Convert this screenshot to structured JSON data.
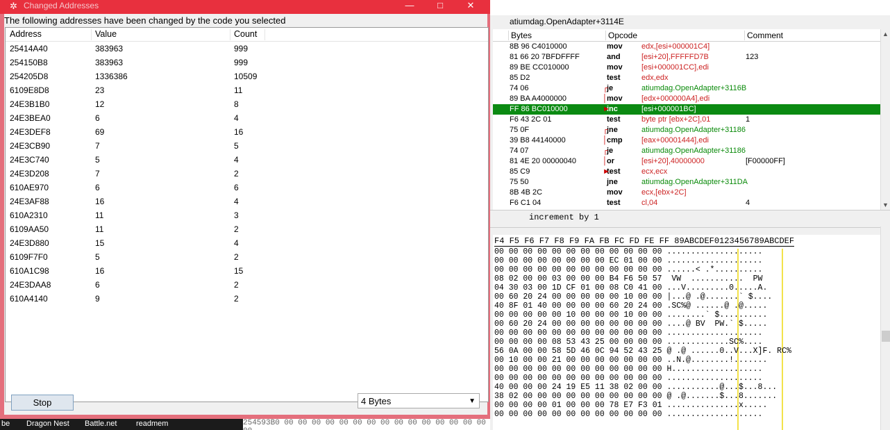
{
  "dialog": {
    "title": "Changed Addresses",
    "message": "The following addresses have been changed by the code you selected",
    "columns": [
      "Address",
      "Value",
      "Count"
    ],
    "rows": [
      [
        "25414A40",
        "383963",
        "999"
      ],
      [
        "254150B8",
        "383963",
        "999"
      ],
      [
        "254205D8",
        "1336386",
        "10509"
      ],
      [
        "6109E8D8",
        "23",
        "11"
      ],
      [
        "24E3B1B0",
        "12",
        "8"
      ],
      [
        "24E3BEA0",
        "6",
        "4"
      ],
      [
        "24E3DEF8",
        "69",
        "16"
      ],
      [
        "24E3CB90",
        "7",
        "5"
      ],
      [
        "24E3C740",
        "5",
        "4"
      ],
      [
        "24E3D208",
        "7",
        "2"
      ],
      [
        "610AE970",
        "6",
        "6"
      ],
      [
        "24E3AF88",
        "16",
        "4"
      ],
      [
        "610A2310",
        "11",
        "3"
      ],
      [
        "6109AA50",
        "11",
        "2"
      ],
      [
        "24E3D880",
        "15",
        "4"
      ],
      [
        "6109F7F0",
        "5",
        "2"
      ],
      [
        "610A1C98",
        "16",
        "15"
      ],
      [
        "24E3DAA8",
        "6",
        "2"
      ],
      [
        "610A4140",
        "9",
        "2"
      ]
    ],
    "stop_label": "Stop",
    "size_value": "4 Bytes",
    "minimize_glyph": "—",
    "maximize_glyph": "□",
    "close_glyph": "✕"
  },
  "disassembler": {
    "address_label": "atiumdag.OpenAdapter+3114E",
    "columns": [
      "Bytes",
      "Opcode",
      "Comment"
    ],
    "rows": [
      {
        "bytes": "8B 96 C4010000",
        "op": "mov",
        "arg": "edx,[esi+000001C4]",
        "comment": ""
      },
      {
        "bytes": "81 66 20 7BFDFFFF",
        "op": "and",
        "arg": "[esi+20],FFFFFD7B",
        "comment": "123"
      },
      {
        "bytes": "89 BE CC010000",
        "op": "mov",
        "arg": "[esi+000001CC],edi",
        "comment": ""
      },
      {
        "bytes": "85 D2",
        "op": "test",
        "arg": "edx,edx",
        "comment": ""
      },
      {
        "bytes": "74 06",
        "op": "je",
        "arg": "atiumdag.OpenAdapter+3116B",
        "comment": ""
      },
      {
        "bytes": "89 BA A4000000",
        "op": "mov",
        "arg": "[edx+000000A4],edi",
        "comment": ""
      },
      {
        "bytes": "FF 86 BC010000",
        "op": "inc",
        "arg": "[esi+000001BC]",
        "comment": ""
      },
      {
        "bytes": "F6 43 2C 01",
        "op": "test",
        "arg": "byte ptr [ebx+2C],01",
        "comment": "1"
      },
      {
        "bytes": "75 0F",
        "op": "jne",
        "arg": "atiumdag.OpenAdapter+31186",
        "comment": ""
      },
      {
        "bytes": "39 B8 44140000",
        "op": "cmp",
        "arg": "[eax+00001444],edi",
        "comment": ""
      },
      {
        "bytes": "74 07",
        "op": "je",
        "arg": "atiumdag.OpenAdapter+31186",
        "comment": ""
      },
      {
        "bytes": "81 4E 20 00000040",
        "op": "or",
        "arg": "[esi+20],40000000",
        "comment": "[F00000FF]"
      },
      {
        "bytes": "85 C9",
        "op": "test",
        "arg": "ecx,ecx",
        "comment": ""
      },
      {
        "bytes": "75 50",
        "op": "jne",
        "arg": "atiumdag.OpenAdapter+311DA",
        "comment": ""
      },
      {
        "bytes": "8B 4B 2C",
        "op": "mov",
        "arg": "ecx,[ebx+2C]",
        "comment": ""
      },
      {
        "bytes": "F6 C1 04",
        "op": "test",
        "arg": "cl,04",
        "comment": "4"
      }
    ],
    "selected_row": 6,
    "status_text": "increment by 1"
  },
  "hexview": {
    "header": "F4 F5 F6 F7 F8 F9 FA FB FC FD FE FF 89ABCDEF0123456789ABCDEF",
    "rows": [
      "00 00 00 00 00 00 00 00 00 00 00 00 ....................",
      "00 00 00 00 00 00 00 00 EC 01 00 00 ....................",
      "00 00 00 00 00 00 00 00 00 00 00 00 ......< .*..........",
      "08 02 00 00 03 00 00 00 B4 F6 50 57  VW  ...........  PW",
      "04 30 03 00 1D CF 01 00 08 C0 41 00 ...V.........0.....A.",
      "00 60 20 24 00 00 00 00 00 10 00 00 |...@ .@.......` $....",
      "40 8F 01 40 00 00 00 00 60 20 24 00 .SC%@ ......@ .@.....",
      "00 00 00 00 00 10 00 00 00 10 00 00 ........` $..........",
      "00 60 20 24 00 00 00 00 00 00 00 00 ....@ BV  PW.` $.....",
      "00 00 00 00 00 00 00 00 00 00 00 00 ....................",
      "00 00 00 00 08 53 43 25 00 00 00 00 .............SC%....",
      "56 0A 00 00 58 5D 46 0C 94 52 43 25 @ .@ ......0..V...X]F. RC%",
      "00 10 00 00 21 00 00 00 00 00 00 00 ..N.@........!.......",
      "00 00 00 00 00 00 00 00 00 00 00 00 H...................",
      "00 00 00 00 00 00 00 00 00 00 00 00 ....................",
      "40 00 00 00 24 19 E5 11 38 02 00 00 ...........@...$...8...",
      "38 02 00 00 00 00 00 00 00 00 00 00 @ .@.......$...8.......",
      "00 00 00 00 01 00 00 00 78 E7 F3 01 ...............x.....",
      "00 00 00 00 00 00 00 00 00 00 00 00 ...................."
    ]
  },
  "taskbar": {
    "items": [
      "be",
      "Dragon Nest",
      "Battle.net",
      "readmem"
    ]
  },
  "behind_text": "254593B0  00 00 00 00 00 00 00 00 00 00 00 00 00 00 00 00"
}
